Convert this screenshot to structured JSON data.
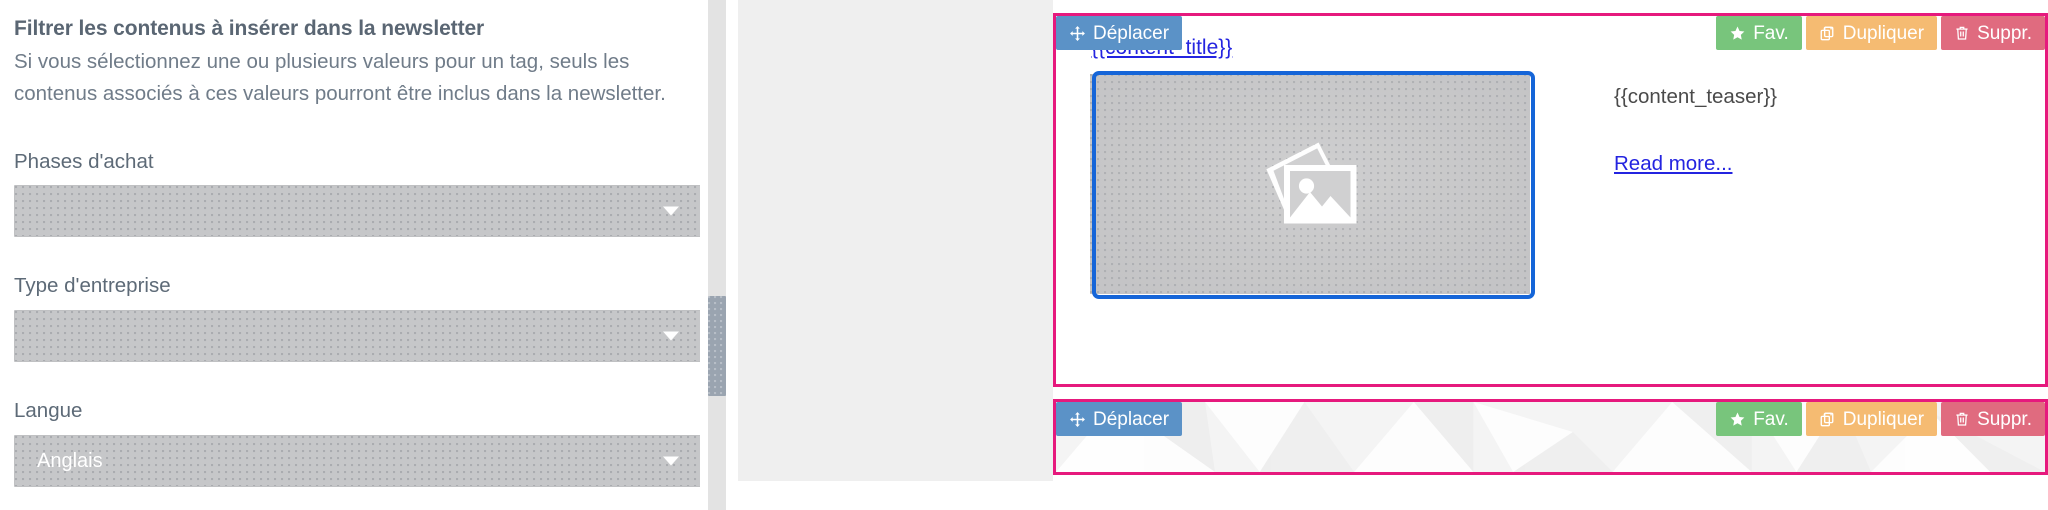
{
  "filter_panel": {
    "title": "Filtrer les contenus à insérer dans la newsletter",
    "description": "Si vous sélectionnez une ou plusieurs valeurs pour un tag, seuls les contenus associés à ces valeurs pourront être inclus dans la newsletter.",
    "fields": [
      {
        "label": "Phases d'achat",
        "value": "",
        "caret_icon": "chevron-down-icon"
      },
      {
        "label": "Type d'entreprise",
        "value": "",
        "caret_icon": "chevron-down-icon"
      },
      {
        "label": "Langue",
        "value": "Anglais",
        "caret_icon": "chevron-down-icon"
      }
    ]
  },
  "scrollbar": {
    "orientation": "vertical",
    "thumb_name": "vertical-scrollbar-thumb"
  },
  "preview": {
    "blocks": [
      {
        "id": "content-teaser",
        "move_label": "Déplacer",
        "move_icon": "move-arrows-icon",
        "actions": [
          {
            "label": "Fav.",
            "icon": "star-icon",
            "color": "#78c57c"
          },
          {
            "label": "Dupliquer",
            "icon": "copy-icon",
            "color": "#f5bb72"
          },
          {
            "label": "Suppr.",
            "icon": "trash-icon",
            "color": "#e06b7f"
          }
        ],
        "title_placeholder": "{{content_title}}",
        "image_icon": "image-stack-placeholder-icon",
        "teaser_placeholder": "{{content_teaser}}",
        "read_more_label": "Read more..."
      },
      {
        "id": "footer-image",
        "move_label": "Déplacer",
        "move_icon": "move-arrows-icon",
        "actions": [
          {
            "label": "Fav.",
            "icon": "star-icon",
            "color": "#78c57c"
          },
          {
            "label": "Dupliquer",
            "icon": "copy-icon",
            "color": "#f5bb72"
          },
          {
            "label": "Suppr.",
            "icon": "trash-icon",
            "color": "#e06b7f"
          }
        ]
      }
    ]
  },
  "colors": {
    "block_border": "#e6197d",
    "move_button": "#5b92c7",
    "fav_button": "#78c57c",
    "duplicate_button": "#f5bb72",
    "delete_button": "#e06b7f",
    "link": "#2424e0",
    "image_selection": "#1565d8",
    "select_background": "#c6c7c9",
    "canvas_backdrop": "#efefef"
  }
}
